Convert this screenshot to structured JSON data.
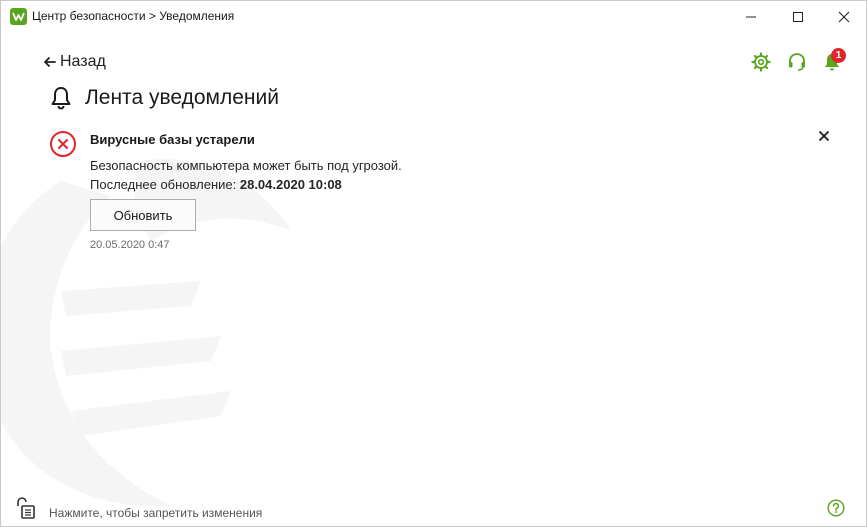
{
  "window": {
    "title": "Центр безопасности > Уведомления",
    "controls": [
      "minimize-icon",
      "maximize-icon",
      "close-icon"
    ]
  },
  "header": {
    "back_label": "Назад",
    "page_title": "Лента уведомлений",
    "icons": [
      "gear-icon",
      "headset-icon",
      "bell-icon"
    ],
    "notification_count": "1"
  },
  "notification": {
    "title": "Вирусные базы устарели",
    "message": "Безопасность компьютера может быть под угрозой.",
    "last_update_label": "Последнее обновление:",
    "last_update_value": "28.04.2020 10:08",
    "action_label": "Обновить",
    "timestamp": "20.05.2020 0:47"
  },
  "footer": {
    "lock_text": "Нажмите, чтобы запретить изменения"
  },
  "colors": {
    "accent_green": "#5aa51e",
    "error_red": "#e0252c",
    "badge_red": "#e0252c"
  }
}
